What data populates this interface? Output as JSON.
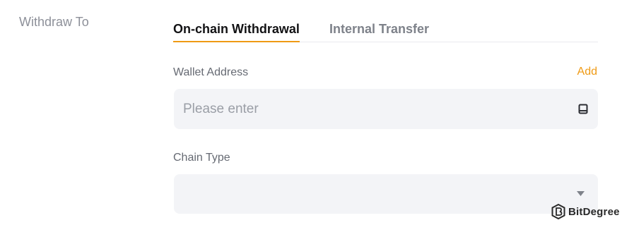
{
  "section": {
    "label": "Withdraw To"
  },
  "tabs": [
    {
      "label": "On-chain Withdrawal",
      "active": true
    },
    {
      "label": "Internal Transfer",
      "active": false
    }
  ],
  "wallet_address": {
    "label": "Wallet Address",
    "add_label": "Add",
    "placeholder": "Please enter",
    "value": "",
    "icon": "address-book-icon"
  },
  "chain_type": {
    "label": "Chain Type",
    "selected": "",
    "icon": "caret-down-icon"
  },
  "watermark": {
    "text": "BitDegree"
  },
  "colors": {
    "accent": "#ef9a14",
    "input_bg": "#f3f4f7",
    "muted_text": "#8d9099"
  }
}
